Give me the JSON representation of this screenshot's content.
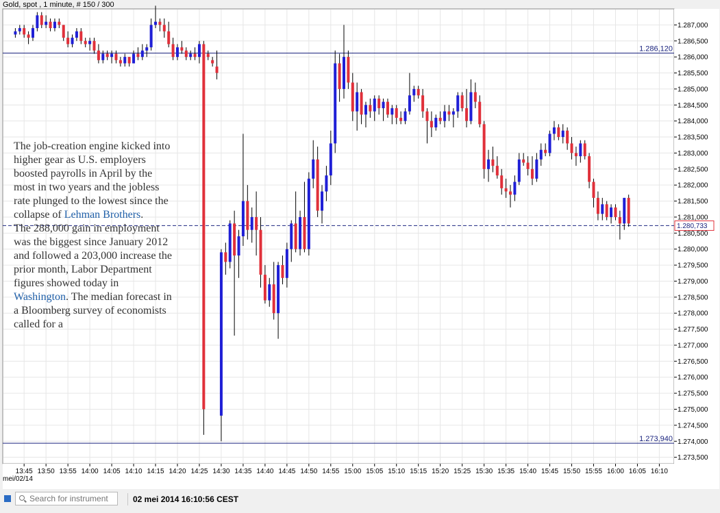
{
  "header": {
    "title": "Gold, spot , 1 minute, # 150 / 300"
  },
  "date_label": "mei/02/14",
  "levels": {
    "upper_label": "1.286,120",
    "lower_label": "1.273,940",
    "current_label": "1.280,733"
  },
  "colors": {
    "up": "#1f1fd6",
    "down": "#e0303a",
    "level_line": "#1a237e",
    "grid": "#e6e6e6"
  },
  "news": {
    "p1_before": "The job-creation engine kicked into higher gear as U.S. employers boosted payrolls in April by the most in two years and the jobless rate plunged to the lowest since the collapse of ",
    "p1_link": "Lehman Brothers",
    "p1_after": ".",
    "p2_before": "The 288,000 gain in employment was the biggest since January 2012 and followed a 203,000 increase the prior month, Labor Department figures showed today in ",
    "p2_link": "Washington",
    "p2_after": ". The median forecast in a Bloomberg survey of economists called for a"
  },
  "statusbar": {
    "search_placeholder": "Search for instrument",
    "search_icon": "search-icon",
    "timestamp": "02 mei 2014 16:10:56 CEST"
  },
  "chart_data": {
    "type": "candlestick",
    "title": "Gold, spot , 1 minute, # 150 / 300",
    "ylim": [
      1273300,
      1287500
    ],
    "yticks": [
      1273500,
      1274000,
      1274500,
      1275000,
      1275500,
      1276000,
      1276500,
      1277000,
      1277500,
      1278000,
      1278500,
      1279000,
      1279500,
      1280000,
      1280500,
      1281000,
      1281500,
      1282000,
      1282500,
      1283000,
      1283500,
      1284000,
      1284500,
      1285000,
      1285500,
      1286000,
      1286500,
      1287000
    ],
    "ytick_labels": [
      "1.273,500",
      "1.274,000",
      "1.274,500",
      "1.275,000",
      "1.275,500",
      "1.276,000",
      "1.276,500",
      "1.277,000",
      "1.277,500",
      "1.278,000",
      "1.278,500",
      "1.279,000",
      "1.279,500",
      "1.280,000",
      "1.280,500",
      "1.281,000",
      "1.281,500",
      "1.282,000",
      "1.282,500",
      "1.283,000",
      "1.283,500",
      "1.284,000",
      "1.284,500",
      "1.285,000",
      "1.285,500",
      "1.286,000",
      "1.286,500",
      "1.287,000"
    ],
    "xticks": [
      "13:45",
      "13:50",
      "13:55",
      "14:00",
      "14:05",
      "14:10",
      "14:15",
      "14:20",
      "14:25",
      "14:30",
      "14:35",
      "14:40",
      "14:45",
      "14:50",
      "14:55",
      "15:00",
      "15:05",
      "15:10",
      "15:15",
      "15:20",
      "15:25",
      "15:30",
      "15:35",
      "15:40",
      "15:45",
      "15:50",
      "15:55",
      "16:00",
      "16:05",
      "16:10"
    ],
    "xlim": [
      "13:42",
      "16:14"
    ],
    "upper_level": 1286120,
    "lower_level": 1273940,
    "current": 1280733,
    "grid": true,
    "candles": [
      [
        "13:43",
        1286700,
        1286900,
        1286600,
        1286800
      ],
      [
        "13:44",
        1286800,
        1287000,
        1286700,
        1286900
      ],
      [
        "13:45",
        1286900,
        1287000,
        1286600,
        1286700
      ],
      [
        "13:46",
        1286700,
        1286800,
        1286400,
        1286600
      ],
      [
        "13:47",
        1286600,
        1287000,
        1286500,
        1286900
      ],
      [
        "13:48",
        1286900,
        1287400,
        1286800,
        1287300
      ],
      [
        "13:49",
        1287300,
        1287400,
        1286900,
        1287000
      ],
      [
        "13:50",
        1287000,
        1287300,
        1286900,
        1287100
      ],
      [
        "13:51",
        1287100,
        1287200,
        1286800,
        1286900
      ],
      [
        "13:52",
        1286900,
        1287200,
        1286800,
        1287100
      ],
      [
        "13:53",
        1287100,
        1287200,
        1286900,
        1287000
      ],
      [
        "13:54",
        1287000,
        1287000,
        1286500,
        1286600
      ],
      [
        "13:55",
        1286600,
        1286800,
        1286300,
        1286400
      ],
      [
        "13:56",
        1286400,
        1286700,
        1286300,
        1286600
      ],
      [
        "13:57",
        1286600,
        1286900,
        1286500,
        1286800
      ],
      [
        "13:58",
        1286800,
        1286900,
        1286400,
        1286500
      ],
      [
        "13:59",
        1286500,
        1286600,
        1286300,
        1286400
      ],
      [
        "14:00",
        1286400,
        1286600,
        1286200,
        1286500
      ],
      [
        "14:01",
        1286500,
        1286600,
        1286100,
        1286200
      ],
      [
        "14:02",
        1286200,
        1286400,
        1285800,
        1285900
      ],
      [
        "14:03",
        1285900,
        1286200,
        1285800,
        1286100
      ],
      [
        "14:04",
        1286100,
        1286200,
        1285900,
        1286000
      ],
      [
        "14:05",
        1286000,
        1286200,
        1285800,
        1286100
      ],
      [
        "14:06",
        1286100,
        1286200,
        1285800,
        1285900
      ],
      [
        "14:07",
        1285900,
        1286000,
        1285700,
        1285800
      ],
      [
        "14:08",
        1285800,
        1286100,
        1285700,
        1286000
      ],
      [
        "14:09",
        1286000,
        1286000,
        1285700,
        1285800
      ],
      [
        "14:10",
        1285800,
        1286200,
        1285800,
        1286100
      ],
      [
        "14:11",
        1286100,
        1286300,
        1285900,
        1286000
      ],
      [
        "14:12",
        1286000,
        1286400,
        1285900,
        1286200
      ],
      [
        "14:13",
        1286200,
        1286400,
        1286000,
        1286300
      ],
      [
        "14:14",
        1286300,
        1287200,
        1286200,
        1287000
      ],
      [
        "14:15",
        1287000,
        1287600,
        1286900,
        1287100
      ],
      [
        "14:16",
        1287100,
        1287200,
        1286800,
        1287000
      ],
      [
        "14:17",
        1287000,
        1287200,
        1286600,
        1286800
      ],
      [
        "14:18",
        1286800,
        1287100,
        1286300,
        1286400
      ],
      [
        "14:19",
        1286400,
        1286600,
        1285900,
        1286000
      ],
      [
        "14:20",
        1286000,
        1286400,
        1285900,
        1286300
      ],
      [
        "14:21",
        1286300,
        1286500,
        1286100,
        1286200
      ],
      [
        "14:22",
        1286200,
        1286300,
        1285900,
        1286000
      ],
      [
        "14:23",
        1286000,
        1286200,
        1285900,
        1286100
      ],
      [
        "14:24",
        1286100,
        1286300,
        1285900,
        1286000
      ],
      [
        "14:25",
        1286000,
        1286500,
        1285800,
        1286400
      ],
      [
        "14:26",
        1286400,
        1286500,
        1274200,
        1275000
      ],
      [
        "14:27",
        1286100,
        1286200,
        1285900,
        1286000
      ],
      [
        "14:28",
        1285900,
        1286000,
        1285700,
        1285800
      ],
      [
        "14:29",
        1285700,
        1286200,
        1285300,
        1285500
      ],
      [
        "14:30",
        1274800,
        1280000,
        1274000,
        1279900
      ],
      [
        "14:31",
        1279900,
        1280200,
        1279200,
        1279600
      ],
      [
        "14:32",
        1279600,
        1280900,
        1279400,
        1280800
      ],
      [
        "14:33",
        1280800,
        1281200,
        1277300,
        1279800
      ],
      [
        "14:34",
        1279800,
        1280600,
        1279100,
        1280400
      ],
      [
        "14:35",
        1280400,
        1283600,
        1280100,
        1281500
      ],
      [
        "14:36",
        1281500,
        1282000,
        1280300,
        1280600
      ],
      [
        "14:37",
        1280600,
        1281300,
        1280200,
        1281000
      ],
      [
        "14:38",
        1281000,
        1281800,
        1279800,
        1280600
      ],
      [
        "14:39",
        1280600,
        1281000,
        1278800,
        1279200
      ],
      [
        "14:40",
        1279200,
        1279500,
        1278300,
        1278400
      ],
      [
        "14:41",
        1278400,
        1279100,
        1278200,
        1278900
      ],
      [
        "14:42",
        1278900,
        1279600,
        1277800,
        1278000
      ],
      [
        "14:43",
        1278000,
        1279600,
        1277200,
        1279500
      ],
      [
        "14:44",
        1279500,
        1279800,
        1278900,
        1279100
      ],
      [
        "14:45",
        1279100,
        1280200,
        1278800,
        1280000
      ],
      [
        "14:46",
        1280000,
        1280900,
        1279600,
        1280800
      ],
      [
        "14:47",
        1280800,
        1281800,
        1279900,
        1280000
      ],
      [
        "14:48",
        1280000,
        1281200,
        1279800,
        1281000
      ],
      [
        "14:49",
        1281000,
        1282100,
        1279900,
        1280000
      ],
      [
        "14:50",
        1280000,
        1282400,
        1279800,
        1282200
      ],
      [
        "14:51",
        1282200,
        1283400,
        1281900,
        1282800
      ],
      [
        "14:52",
        1282800,
        1283200,
        1281000,
        1281200
      ],
      [
        "14:53",
        1281200,
        1282000,
        1280800,
        1281800
      ],
      [
        "14:54",
        1281800,
        1282600,
        1281500,
        1282300
      ],
      [
        "14:55",
        1282300,
        1283700,
        1282000,
        1283300
      ],
      [
        "14:56",
        1283300,
        1286200,
        1283000,
        1285800
      ],
      [
        "14:57",
        1285800,
        1286100,
        1284600,
        1285000
      ],
      [
        "14:58",
        1285000,
        1287000,
        1284700,
        1286000
      ],
      [
        "14:59",
        1286000,
        1286200,
        1285000,
        1285200
      ],
      [
        "15:00",
        1285200,
        1285500,
        1284000,
        1284300
      ],
      [
        "15:01",
        1284300,
        1285200,
        1283700,
        1284900
      ],
      [
        "15:02",
        1284900,
        1285000,
        1283900,
        1284200
      ],
      [
        "15:03",
        1284200,
        1284600,
        1283800,
        1284500
      ],
      [
        "15:04",
        1284500,
        1284700,
        1284100,
        1284300
      ],
      [
        "15:05",
        1284300,
        1284800,
        1284000,
        1284700
      ],
      [
        "15:06",
        1284700,
        1284800,
        1284200,
        1284400
      ],
      [
        "15:07",
        1284400,
        1284700,
        1284000,
        1284600
      ],
      [
        "15:08",
        1284600,
        1284700,
        1284100,
        1284200
      ],
      [
        "15:09",
        1284200,
        1284500,
        1283900,
        1284400
      ],
      [
        "15:10",
        1284400,
        1284500,
        1283900,
        1284100
      ],
      [
        "15:11",
        1284100,
        1284300,
        1283900,
        1284000
      ],
      [
        "15:12",
        1284000,
        1284400,
        1283900,
        1284300
      ],
      [
        "15:13",
        1284300,
        1285500,
        1284200,
        1284800
      ],
      [
        "15:14",
        1284800,
        1285100,
        1284600,
        1285000
      ],
      [
        "15:15",
        1285000,
        1285100,
        1284700,
        1284800
      ],
      [
        "15:16",
        1284800,
        1285000,
        1284100,
        1284300
      ],
      [
        "15:17",
        1284300,
        1284400,
        1283300,
        1284000
      ],
      [
        "15:18",
        1284000,
        1284300,
        1283500,
        1283800
      ],
      [
        "15:19",
        1283800,
        1284200,
        1283700,
        1284100
      ],
      [
        "15:20",
        1284100,
        1284300,
        1283900,
        1284000
      ],
      [
        "15:21",
        1284000,
        1284500,
        1283800,
        1284300
      ],
      [
        "15:22",
        1284300,
        1284500,
        1284000,
        1284200
      ],
      [
        "15:23",
        1284200,
        1284400,
        1283800,
        1284300
      ],
      [
        "15:24",
        1284300,
        1284900,
        1284100,
        1284800
      ],
      [
        "15:25",
        1284800,
        1284900,
        1284300,
        1284400
      ],
      [
        "15:26",
        1284400,
        1285000,
        1283800,
        1284000
      ],
      [
        "15:27",
        1284000,
        1285300,
        1283900,
        1284900
      ],
      [
        "15:28",
        1284900,
        1285200,
        1284400,
        1284600
      ],
      [
        "15:29",
        1284600,
        1284800,
        1283800,
        1283900
      ],
      [
        "15:30",
        1283900,
        1284000,
        1282200,
        1282500
      ],
      [
        "15:31",
        1282500,
        1283100,
        1282100,
        1282800
      ],
      [
        "15:32",
        1282800,
        1283200,
        1282400,
        1282600
      ],
      [
        "15:33",
        1282600,
        1282900,
        1282200,
        1282300
      ],
      [
        "15:34",
        1282300,
        1282500,
        1281700,
        1281900
      ],
      [
        "15:35",
        1281900,
        1282200,
        1281600,
        1281800
      ],
      [
        "15:36",
        1281800,
        1282000,
        1281300,
        1281700
      ],
      [
        "15:37",
        1281700,
        1282300,
        1281500,
        1282100
      ],
      [
        "15:38",
        1282100,
        1283000,
        1282000,
        1282800
      ],
      [
        "15:39",
        1282800,
        1283000,
        1282600,
        1282700
      ],
      [
        "15:40",
        1282700,
        1282900,
        1282300,
        1282500
      ],
      [
        "15:41",
        1282500,
        1282900,
        1282000,
        1282200
      ],
      [
        "15:42",
        1282200,
        1283000,
        1282100,
        1282800
      ],
      [
        "15:43",
        1282800,
        1283300,
        1282600,
        1283100
      ],
      [
        "15:44",
        1283100,
        1283300,
        1282900,
        1283000
      ],
      [
        "15:45",
        1283000,
        1283700,
        1282900,
        1283600
      ],
      [
        "15:46",
        1283600,
        1284000,
        1283400,
        1283800
      ],
      [
        "15:47",
        1283800,
        1283900,
        1283400,
        1283500
      ],
      [
        "15:48",
        1283500,
        1283900,
        1283300,
        1283700
      ],
      [
        "15:49",
        1283700,
        1283800,
        1283100,
        1283300
      ],
      [
        "15:50",
        1283300,
        1283500,
        1282800,
        1283000
      ],
      [
        "15:51",
        1283000,
        1283200,
        1282600,
        1282900
      ],
      [
        "15:52",
        1282900,
        1283400,
        1282700,
        1283300
      ],
      [
        "15:53",
        1283300,
        1283400,
        1282800,
        1282900
      ],
      [
        "15:54",
        1282900,
        1283000,
        1281900,
        1282100
      ],
      [
        "15:55",
        1282100,
        1282200,
        1281300,
        1281600
      ],
      [
        "15:56",
        1281600,
        1281800,
        1280900,
        1281100
      ],
      [
        "15:57",
        1281100,
        1281600,
        1280900,
        1281400
      ],
      [
        "15:58",
        1281400,
        1281500,
        1280900,
        1281000
      ],
      [
        "15:59",
        1281000,
        1281400,
        1280800,
        1281300
      ],
      [
        "16:00",
        1281300,
        1281400,
        1280900,
        1281000
      ],
      [
        "16:01",
        1281000,
        1281200,
        1280300,
        1280800
      ],
      [
        "16:02",
        1280800,
        1281600,
        1280600,
        1281600
      ],
      [
        "16:03",
        1281600,
        1281700,
        1280700,
        1280800
      ]
    ]
  }
}
